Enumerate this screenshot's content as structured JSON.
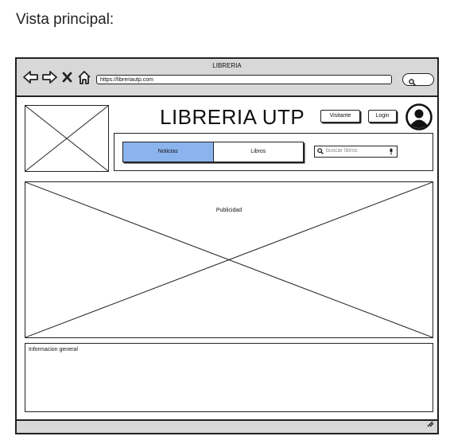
{
  "caption": "Vista principal:",
  "window": {
    "title": "LIBRERIA",
    "url": "https://libreriautp.com",
    "nav_icons": [
      "back-arrow-icon",
      "forward-arrow-icon",
      "close-icon",
      "home-icon"
    ]
  },
  "header": {
    "app_title": "LIBRERIA UTP",
    "visitor_button": "Visitante",
    "login_button": "Login"
  },
  "nav": {
    "tabs": [
      {
        "label": "Noticias",
        "active": true
      },
      {
        "label": "Libros",
        "active": false
      }
    ],
    "search_placeholder": "buscar libros"
  },
  "main": {
    "ad_label": "Publicidad",
    "info_label": "Informacion general"
  },
  "colors": {
    "active_tab": "#8bb4ef",
    "chrome": "#d8d8d8",
    "stroke": "#222222"
  }
}
